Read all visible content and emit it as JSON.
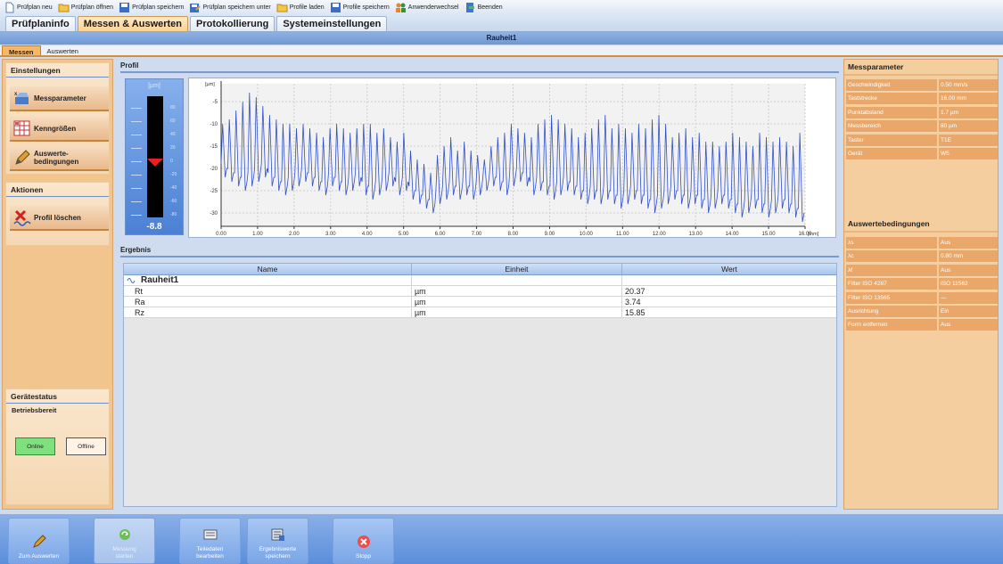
{
  "toolbar": [
    {
      "label": "Prüfplan neu",
      "icon": "new-doc-icon"
    },
    {
      "label": "Prüfplan öffnen",
      "icon": "folder-open-icon"
    },
    {
      "label": "Prüfplan speichern",
      "icon": "save-icon"
    },
    {
      "label": "Prüfplan speichern unter",
      "icon": "save-as-icon"
    },
    {
      "label": "Profile laden",
      "icon": "folder-open-icon"
    },
    {
      "label": "Profile speichern",
      "icon": "save-icon"
    },
    {
      "label": "Anwenderwechsel",
      "icon": "users-icon"
    },
    {
      "label": "Beenden",
      "icon": "exit-icon"
    }
  ],
  "tabs": [
    {
      "label": "Prüfplaninfo"
    },
    {
      "label": "Messen & Auswerten"
    },
    {
      "label": "Protokollierung"
    },
    {
      "label": "Systemeinstellungen"
    }
  ],
  "active_tab": 1,
  "title": "Rauheit1",
  "subtabs": [
    {
      "label": "Messen"
    },
    {
      "label": "Auswerten"
    }
  ],
  "left": {
    "settings_title": "Einstellungen",
    "btn_messparameter": "Messparameter",
    "btn_kenngroessen": "Kenngrößen",
    "btn_auswerte_1": "Auswerte-",
    "btn_auswerte_2": "bedingungen",
    "actions_title": "Aktionen",
    "btn_profil_loeschen": "Profil löschen",
    "status_title": "Gerätestatus",
    "status_text": "Betriebsbereit",
    "btn_online": "Online",
    "btn_offline": "Offline"
  },
  "profil": {
    "title": "Profil",
    "gauge_unit": "[µm]",
    "gauge_value": "-8.8",
    "gauge_ticks": [
      "80",
      "60",
      "40",
      "20",
      "0",
      "-20",
      "-40",
      "-60",
      "-80"
    ],
    "ylabel": "[µm]",
    "xlabel": "[mm]"
  },
  "chart_data": {
    "type": "line",
    "xlim": [
      0,
      16
    ],
    "ylim": [
      -33,
      -1
    ],
    "xticks": [
      "0.00",
      "1.00",
      "2.00",
      "3.00",
      "4.00",
      "5.00",
      "6.00",
      "7.00",
      "8.00",
      "9.00",
      "10.00",
      "11.00",
      "12.00",
      "13.00",
      "14.00",
      "15.00",
      "16.00"
    ],
    "yticks": [
      -5,
      -10,
      -15,
      -20,
      -25,
      -30
    ],
    "ylabel": "[µm]",
    "xlabel": "[mm]",
    "peaks": [
      -10,
      -9,
      -7,
      -5,
      -3,
      -4,
      -6,
      -8,
      -9,
      -10,
      -10,
      -11,
      -10,
      -11,
      -12,
      -13,
      -11,
      -10,
      -11,
      -12,
      -11,
      -10,
      -10,
      -12,
      -11,
      -13,
      -14,
      -12,
      -16,
      -18,
      -19,
      -21,
      -17,
      -15,
      -13,
      -16,
      -14,
      -16,
      -17,
      -18,
      -15,
      -13,
      -12,
      -10,
      -11,
      -12,
      -13,
      -10,
      -9,
      -8,
      -9,
      -10,
      -11,
      -13,
      -12,
      -11,
      -9,
      -8,
      -11,
      -10,
      -11,
      -12,
      -10,
      -11,
      -9,
      -8,
      -10,
      -13,
      -12,
      -11,
      -13,
      -12,
      -14,
      -14,
      -15,
      -14,
      -12,
      -13,
      -14,
      -15,
      -12,
      -13,
      -14,
      -13,
      -14,
      -15,
      -12
    ],
    "valleys": [
      -22,
      -23,
      -24,
      -25,
      -24,
      -23,
      -22,
      -24,
      -25,
      -26,
      -25,
      -24,
      -23,
      -24,
      -25,
      -26,
      -24,
      -25,
      -26,
      -25,
      -24,
      -26,
      -27,
      -26,
      -25,
      -24,
      -26,
      -25,
      -27,
      -28,
      -29,
      -30,
      -28,
      -27,
      -26,
      -27,
      -26,
      -27,
      -26,
      -25,
      -24,
      -25,
      -26,
      -24,
      -23,
      -24,
      -26,
      -25,
      -26,
      -27,
      -26,
      -25,
      -26,
      -27,
      -28,
      -27,
      -28,
      -27,
      -28,
      -29,
      -28,
      -27,
      -28,
      -29,
      -30,
      -29,
      -28,
      -27,
      -28,
      -29,
      -28,
      -29,
      -30,
      -29,
      -28,
      -29,
      -30,
      -31,
      -30,
      -29,
      -30,
      -31,
      -30,
      -29,
      -30,
      -31,
      -32
    ]
  },
  "result": {
    "title": "Ergebnis",
    "columns": [
      "Name",
      "Einheit",
      "Wert"
    ],
    "group": "Rauheit1",
    "rows": [
      {
        "name": "Rt",
        "unit": "µm",
        "value": "20.37"
      },
      {
        "name": "Ra",
        "unit": "µm",
        "value": "3.74"
      },
      {
        "name": "Rz",
        "unit": "µm",
        "value": "15.85"
      }
    ]
  },
  "right": {
    "mess_title": "Messparameter",
    "mess_rows": [
      {
        "k": "Geschwindigkeit",
        "v": "0.50 mm/s"
      },
      {
        "k": "Taststrecke",
        "v": "16.00 mm"
      },
      {
        "k": "Punktabstand",
        "v": "1.7 µm"
      },
      {
        "k": "Messbereich",
        "v": "80 µm"
      },
      {
        "k": "Taster",
        "v": "T1E"
      },
      {
        "k": "Gerät",
        "v": "W5"
      }
    ],
    "ausw_title": "Auswertebedingungen",
    "ausw_rows": [
      {
        "k": "λs",
        "v": "Aus"
      },
      {
        "k": "λc",
        "v": "0.80 mm"
      },
      {
        "k": "λf",
        "v": "Aus"
      },
      {
        "k": "Filter ISO 4287",
        "v": "ISO 11562"
      },
      {
        "k": "Filter ISO 13565",
        "v": "—"
      },
      {
        "k": "Ausrichtung",
        "v": "Ein"
      },
      {
        "k": "Form entfernen",
        "v": "Aus"
      }
    ]
  },
  "bottom": [
    {
      "l1": "Zum Auswerten",
      "l2": "",
      "icon": "pencil-icon",
      "disabled": false
    },
    {
      "l1": "Messung",
      "l2": "starten",
      "icon": "refresh-icon",
      "disabled": true
    },
    {
      "l1": "Teiledaten",
      "l2": "bearbeiten",
      "icon": "keyboard-icon",
      "disabled": false
    },
    {
      "l1": "Ergebniswerte",
      "l2": "speichern",
      "icon": "save-results-icon",
      "disabled": false
    },
    {
      "l1": "Stopp",
      "l2": "",
      "icon": "stop-icon",
      "disabled": false
    }
  ]
}
